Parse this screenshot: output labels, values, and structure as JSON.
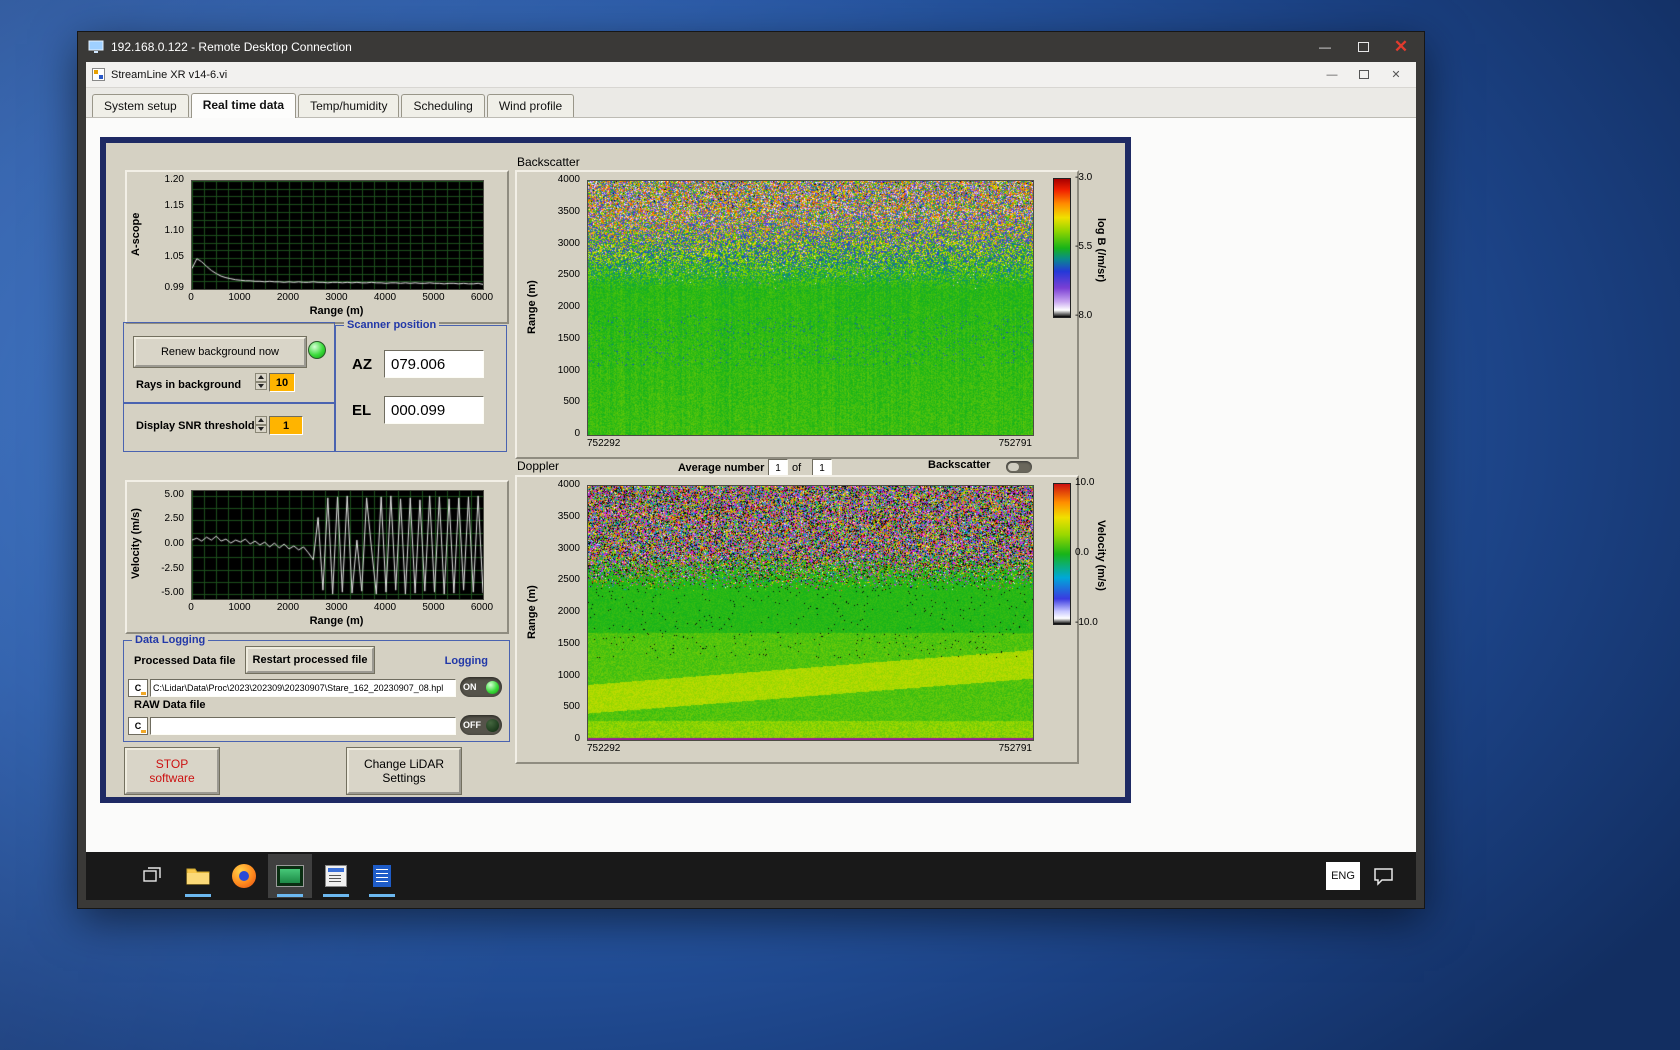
{
  "rdp_window": {
    "title": "192.168.0.122 - Remote Desktop Connection"
  },
  "app_window": {
    "title": "StreamLine XR v14-6.vi",
    "tabs": [
      {
        "label": "System setup"
      },
      {
        "label": "Real time data"
      },
      {
        "label": "Temp/humidity"
      },
      {
        "label": "Scheduling"
      },
      {
        "label": "Wind profile"
      }
    ]
  },
  "panel": {
    "background_controls": {
      "renew_button": "Renew background now",
      "rays_label": "Rays in background",
      "rays_value": "10",
      "snr_label": "Display SNR threshold",
      "snr_value": "1"
    },
    "scanner": {
      "title": "Scanner position",
      "az_label": "AZ",
      "az_value": "079.006",
      "el_label": "EL",
      "el_value": "000.099"
    },
    "average": {
      "label": "Average number",
      "value1": "1",
      "of": "of",
      "value2": "1"
    },
    "backscatter_toggle_label": "Backscatter",
    "data_logging": {
      "title": "Data Logging",
      "processed_label": "Processed Data file",
      "restart_button": "Restart processed file",
      "logging_label": "Logging",
      "drive_label": "C",
      "processed_path": "C:\\Lidar\\Data\\Proc\\2023\\202309\\20230907\\Stare_162_20230907_08.hpl",
      "on_label": "ON",
      "raw_label": "RAW Data file",
      "raw_path": "",
      "off_label": "OFF"
    },
    "stop_line1": "STOP",
    "stop_line2": "software",
    "change_line1": "Change LiDAR",
    "change_line2": "Settings"
  },
  "taskbar": {
    "language": "ENG"
  },
  "chart_data": [
    {
      "id": "ascope",
      "type": "line",
      "ylabel": "A-scope",
      "xlabel": "Range (m)",
      "xlim": [
        0,
        6000
      ],
      "ylim": [
        0.99,
        1.2
      ],
      "xticks": [
        0,
        1000,
        2000,
        3000,
        4000,
        5000,
        6000
      ],
      "yticks": [
        1.2,
        1.15,
        1.1,
        1.05,
        0.99
      ],
      "ytick_decimals": 2,
      "x_minor": 250,
      "y_minor": 0.015,
      "x_step": 100,
      "bg": "#000000",
      "grid_color": "#1d4f1d",
      "line_color": "#e6e6e6",
      "y": [
        1.03,
        1.049,
        1.043,
        1.034,
        1.026,
        1.02,
        1.015,
        1.012,
        1.01,
        1.008,
        1.007,
        1.006,
        1.006,
        1.005,
        1.005,
        1.004,
        1.005,
        1.004,
        1.004,
        1.003,
        1.004,
        1.003,
        1.004,
        1.003,
        1.003,
        1.004,
        1.003,
        1.003,
        1.002,
        1.003,
        1.003,
        1.002,
        1.003,
        1.002,
        1.003,
        1.002,
        1.002,
        1.003,
        1.002,
        1.002,
        1.001,
        1.002,
        1.002,
        1.001,
        1.002,
        1.001,
        1.002,
        1.001,
        1.001,
        1.002,
        1.001,
        1.001,
        1.0,
        1.001,
        1.001,
        1.0,
        1.001,
        1.0,
        1.0,
        1.001,
        0.999
      ]
    },
    {
      "id": "backscatter",
      "type": "heatmap",
      "title": "Backscatter",
      "ylabel": "Range (m)",
      "ylim": [
        0,
        4000
      ],
      "y_range": [
        0,
        4000
      ],
      "yticks": [
        4000,
        3500,
        3000,
        2500,
        2000,
        1500,
        1000,
        500,
        0
      ],
      "ytick_decimals": 0,
      "xtick_labels": [
        "752292",
        "752791"
      ],
      "colorbar": {
        "label": "log B (/m/sr)",
        "min": -8.0,
        "max": -3.0,
        "tick_labels": [
          {
            "text": "-3.0",
            "pos": 1
          },
          {
            "text": "-5.5",
            "pos": 0.5
          },
          {
            "text": "-8.0",
            "pos": 0
          }
        ],
        "stops": [
          [
            0,
            "#000000"
          ],
          [
            0.05,
            "#ffffff"
          ],
          [
            0.11,
            "#c9a7f0"
          ],
          [
            0.21,
            "#7a3fd4"
          ],
          [
            0.33,
            "#2438d8"
          ],
          [
            0.42,
            "#0a8a8c"
          ],
          [
            0.5,
            "#18b418"
          ],
          [
            0.62,
            "#8fd400"
          ],
          [
            0.72,
            "#f0e000"
          ],
          [
            0.82,
            "#ff8c00"
          ],
          [
            0.92,
            "#f02000"
          ],
          [
            1,
            "#a80000"
          ]
        ]
      },
      "pattern": {
        "kind": "backscatter",
        "seed": 7,
        "base": -5.5,
        "noise_floor": 0.17,
        "col_noise": 0.14,
        "speckle_start": 2300,
        "speckle_full": 3600,
        "speckle_amp": 2.4,
        "dark_prob": 0.1,
        "dark_val": -7.5
      }
    },
    {
      "id": "velocity",
      "type": "line",
      "ylabel": "Velocity (m/s)",
      "xlabel": "Range (m)",
      "xlim": [
        0,
        6000
      ],
      "ylim": [
        -5.5,
        5.5
      ],
      "xticks": [
        0,
        1000,
        2000,
        3000,
        4000,
        5000,
        6000
      ],
      "yticks": [
        5.0,
        2.5,
        0.0,
        -2.5,
        -5.0
      ],
      "ytick_decimals": 2,
      "x_minor": 250,
      "y_minor": 1.25,
      "x_step": 100,
      "bg": "#000000",
      "grid_color": "#1d4f1d",
      "line_color": "#e6e6e6",
      "y": [
        0.5,
        0.7,
        0.4,
        0.8,
        0.5,
        0.9,
        0.4,
        0.6,
        0.2,
        0.5,
        0.3,
        0.6,
        0.1,
        0.4,
        0.0,
        0.3,
        -0.2,
        0.2,
        -0.3,
        0.1,
        -0.4,
        -0.1,
        -0.5,
        -0.2,
        -0.8,
        -1.5,
        2.8,
        -4.6,
        4.8,
        -5.0,
        4.9,
        -4.8,
        5.0,
        -4.9,
        0.5,
        -4.7,
        4.8,
        -0.3,
        -5.0,
        4.9,
        -4.8,
        5.0,
        -4.6,
        4.7,
        -5.0,
        4.8,
        -4.9,
        4.6,
        -4.7,
        5.0,
        -4.8,
        4.9,
        -5.0,
        4.7,
        -4.9,
        4.8,
        -4.6,
        4.9,
        -4.8,
        5.0,
        -4.9
      ]
    },
    {
      "id": "doppler",
      "type": "heatmap",
      "title": "Doppler",
      "ylabel": "Range (m)",
      "ylim": [
        0,
        4000
      ],
      "y_range": [
        0,
        4000
      ],
      "yticks": [
        4000,
        3500,
        3000,
        2500,
        2000,
        1500,
        1000,
        500,
        0
      ],
      "ytick_decimals": 0,
      "xtick_labels": [
        "752292",
        "752791"
      ],
      "colorbar": {
        "label": "Velocity (m/s)",
        "min": -10.0,
        "max": 10.0,
        "tick_labels": [
          {
            "text": "10.0",
            "pos": 1
          },
          {
            "text": "0.0",
            "pos": 0.5
          },
          {
            "text": "-10.0",
            "pos": 0
          }
        ],
        "stops": [
          [
            0,
            "#000000"
          ],
          [
            0.04,
            "#ffffff"
          ],
          [
            0.09,
            "#c8c8ff"
          ],
          [
            0.18,
            "#3a3ae0"
          ],
          [
            0.33,
            "#00a8d8"
          ],
          [
            0.5,
            "#18b418"
          ],
          [
            0.64,
            "#9cd800"
          ],
          [
            0.76,
            "#f0e000"
          ],
          [
            0.87,
            "#ff8c00"
          ],
          [
            1,
            "#cc1010"
          ]
        ]
      },
      "pattern": {
        "kind": "doppler",
        "seed": 13,
        "band_base": 650,
        "band_slope": 550,
        "band_width": 450,
        "band_val": 3.2,
        "low_val": 1.2,
        "mid_val": 0.3,
        "speckle_start": 2350,
        "speckle_full": 2950,
        "black_prob": 0.12,
        "magenta_prob": 0.18
      }
    }
  ]
}
